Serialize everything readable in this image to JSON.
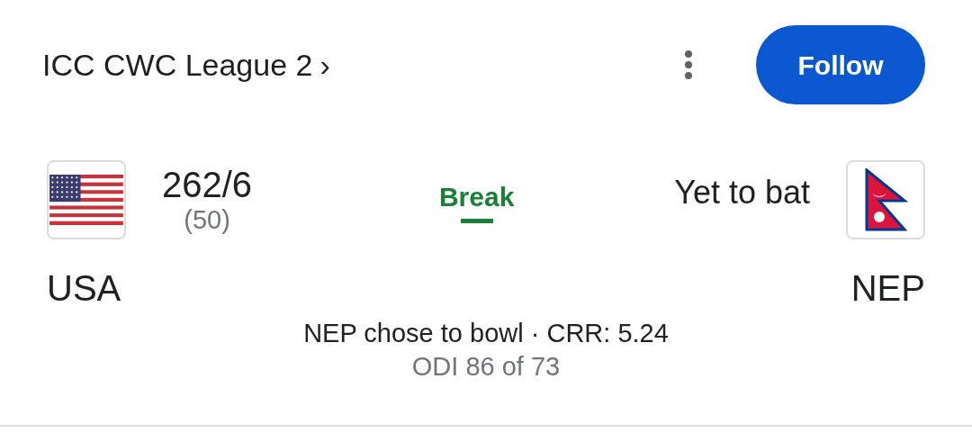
{
  "header": {
    "title": "ICC CWC League 2",
    "chevron": "›",
    "follow_button": "Follow"
  },
  "teams": [
    {
      "kind": "batted",
      "flag": {
        "kind": "usa"
      },
      "name": "USA",
      "score": "262/6",
      "overs": "(50)"
    },
    {
      "kind": "waiting",
      "flag": {
        "kind": "nepal"
      },
      "name": "NEP",
      "status": "Yet to bat"
    }
  ],
  "match_status": "Break",
  "summary": "NEP chose to bowl · CRR: 5.24",
  "match_info": "ODI 86 of 73"
}
